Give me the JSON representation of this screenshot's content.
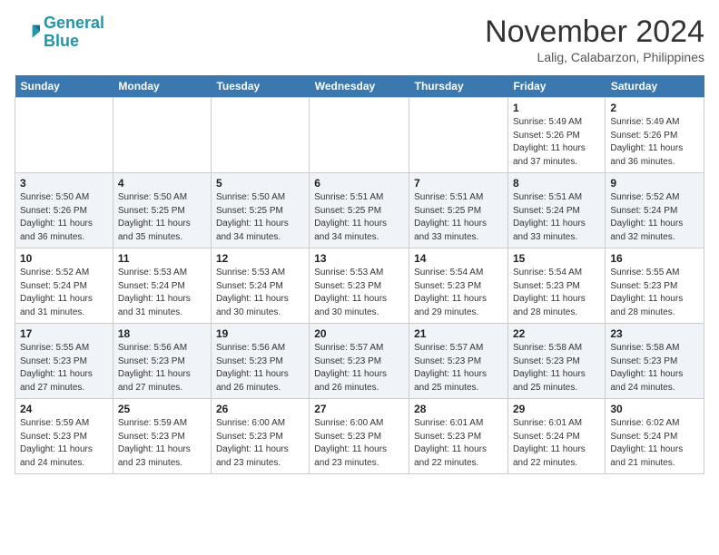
{
  "header": {
    "logo_line1": "General",
    "logo_line2": "Blue",
    "month_title": "November 2024",
    "location": "Lalig, Calabarzon, Philippines"
  },
  "days_of_week": [
    "Sunday",
    "Monday",
    "Tuesday",
    "Wednesday",
    "Thursday",
    "Friday",
    "Saturday"
  ],
  "weeks": [
    [
      {
        "num": "",
        "info": ""
      },
      {
        "num": "",
        "info": ""
      },
      {
        "num": "",
        "info": ""
      },
      {
        "num": "",
        "info": ""
      },
      {
        "num": "",
        "info": ""
      },
      {
        "num": "1",
        "info": "Sunrise: 5:49 AM\nSunset: 5:26 PM\nDaylight: 11 hours and 37 minutes."
      },
      {
        "num": "2",
        "info": "Sunrise: 5:49 AM\nSunset: 5:26 PM\nDaylight: 11 hours and 36 minutes."
      }
    ],
    [
      {
        "num": "3",
        "info": "Sunrise: 5:50 AM\nSunset: 5:26 PM\nDaylight: 11 hours and 36 minutes."
      },
      {
        "num": "4",
        "info": "Sunrise: 5:50 AM\nSunset: 5:25 PM\nDaylight: 11 hours and 35 minutes."
      },
      {
        "num": "5",
        "info": "Sunrise: 5:50 AM\nSunset: 5:25 PM\nDaylight: 11 hours and 34 minutes."
      },
      {
        "num": "6",
        "info": "Sunrise: 5:51 AM\nSunset: 5:25 PM\nDaylight: 11 hours and 34 minutes."
      },
      {
        "num": "7",
        "info": "Sunrise: 5:51 AM\nSunset: 5:25 PM\nDaylight: 11 hours and 33 minutes."
      },
      {
        "num": "8",
        "info": "Sunrise: 5:51 AM\nSunset: 5:24 PM\nDaylight: 11 hours and 33 minutes."
      },
      {
        "num": "9",
        "info": "Sunrise: 5:52 AM\nSunset: 5:24 PM\nDaylight: 11 hours and 32 minutes."
      }
    ],
    [
      {
        "num": "10",
        "info": "Sunrise: 5:52 AM\nSunset: 5:24 PM\nDaylight: 11 hours and 31 minutes."
      },
      {
        "num": "11",
        "info": "Sunrise: 5:53 AM\nSunset: 5:24 PM\nDaylight: 11 hours and 31 minutes."
      },
      {
        "num": "12",
        "info": "Sunrise: 5:53 AM\nSunset: 5:24 PM\nDaylight: 11 hours and 30 minutes."
      },
      {
        "num": "13",
        "info": "Sunrise: 5:53 AM\nSunset: 5:23 PM\nDaylight: 11 hours and 30 minutes."
      },
      {
        "num": "14",
        "info": "Sunrise: 5:54 AM\nSunset: 5:23 PM\nDaylight: 11 hours and 29 minutes."
      },
      {
        "num": "15",
        "info": "Sunrise: 5:54 AM\nSunset: 5:23 PM\nDaylight: 11 hours and 28 minutes."
      },
      {
        "num": "16",
        "info": "Sunrise: 5:55 AM\nSunset: 5:23 PM\nDaylight: 11 hours and 28 minutes."
      }
    ],
    [
      {
        "num": "17",
        "info": "Sunrise: 5:55 AM\nSunset: 5:23 PM\nDaylight: 11 hours and 27 minutes."
      },
      {
        "num": "18",
        "info": "Sunrise: 5:56 AM\nSunset: 5:23 PM\nDaylight: 11 hours and 27 minutes."
      },
      {
        "num": "19",
        "info": "Sunrise: 5:56 AM\nSunset: 5:23 PM\nDaylight: 11 hours and 26 minutes."
      },
      {
        "num": "20",
        "info": "Sunrise: 5:57 AM\nSunset: 5:23 PM\nDaylight: 11 hours and 26 minutes."
      },
      {
        "num": "21",
        "info": "Sunrise: 5:57 AM\nSunset: 5:23 PM\nDaylight: 11 hours and 25 minutes."
      },
      {
        "num": "22",
        "info": "Sunrise: 5:58 AM\nSunset: 5:23 PM\nDaylight: 11 hours and 25 minutes."
      },
      {
        "num": "23",
        "info": "Sunrise: 5:58 AM\nSunset: 5:23 PM\nDaylight: 11 hours and 24 minutes."
      }
    ],
    [
      {
        "num": "24",
        "info": "Sunrise: 5:59 AM\nSunset: 5:23 PM\nDaylight: 11 hours and 24 minutes."
      },
      {
        "num": "25",
        "info": "Sunrise: 5:59 AM\nSunset: 5:23 PM\nDaylight: 11 hours and 23 minutes."
      },
      {
        "num": "26",
        "info": "Sunrise: 6:00 AM\nSunset: 5:23 PM\nDaylight: 11 hours and 23 minutes."
      },
      {
        "num": "27",
        "info": "Sunrise: 6:00 AM\nSunset: 5:23 PM\nDaylight: 11 hours and 23 minutes."
      },
      {
        "num": "28",
        "info": "Sunrise: 6:01 AM\nSunset: 5:23 PM\nDaylight: 11 hours and 22 minutes."
      },
      {
        "num": "29",
        "info": "Sunrise: 6:01 AM\nSunset: 5:24 PM\nDaylight: 11 hours and 22 minutes."
      },
      {
        "num": "30",
        "info": "Sunrise: 6:02 AM\nSunset: 5:24 PM\nDaylight: 11 hours and 21 minutes."
      }
    ]
  ]
}
